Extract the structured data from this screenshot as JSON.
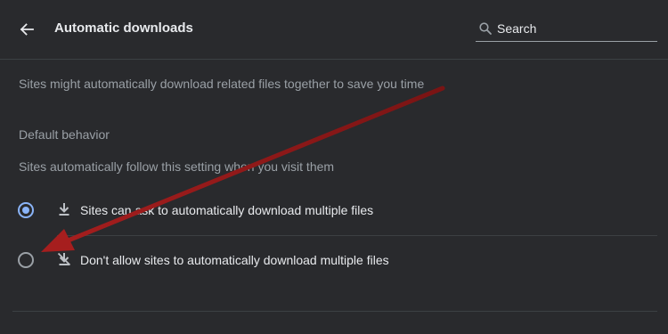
{
  "header": {
    "back_icon": "arrow-back-icon",
    "title": "Automatic downloads",
    "search": {
      "icon": "search-icon",
      "placeholder": "Search",
      "value": ""
    }
  },
  "description": "Sites might automatically download related files together to save you time",
  "default_behavior": {
    "title": "Default behavior",
    "subtitle": "Sites automatically follow this setting when you visit them",
    "options": [
      {
        "label": "Sites can ask to automatically download multiple files",
        "icon": "download-icon",
        "selected": true
      },
      {
        "label": "Don't allow sites to automatically download multiple files",
        "icon": "download-off-icon",
        "selected": false
      }
    ]
  },
  "colors": {
    "background": "#292a2d",
    "accent": "#8ab4f8",
    "text_primary": "#e8eaed",
    "text_secondary": "#9aa0a6",
    "annotation_arrow": "#8b1a1a"
  }
}
